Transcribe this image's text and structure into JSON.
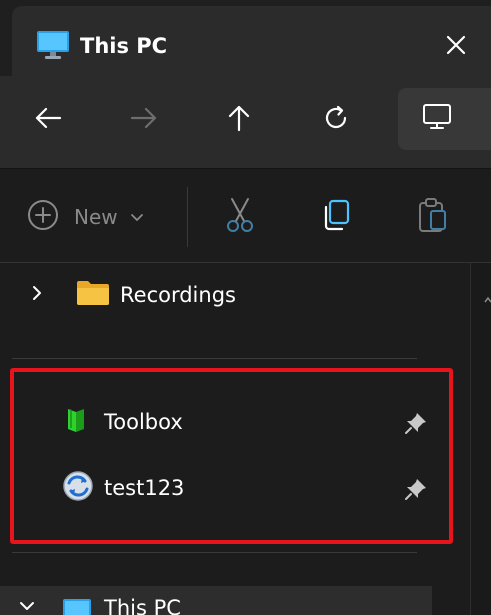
{
  "tab": {
    "title": "This PC",
    "icon": "monitor-icon",
    "close_icon": "close-icon"
  },
  "navigation": {
    "buttons": [
      {
        "name": "back",
        "icon": "arrow-left-icon",
        "enabled": true
      },
      {
        "name": "forward",
        "icon": "arrow-right-icon",
        "enabled": false
      },
      {
        "name": "up",
        "icon": "arrow-up-icon",
        "enabled": true
      },
      {
        "name": "refresh",
        "icon": "refresh-icon",
        "enabled": true
      },
      {
        "name": "view",
        "icon": "monitor-icon",
        "enabled": true
      }
    ]
  },
  "commandbar": {
    "new_label": "New",
    "new_icon": "plus-circle-icon",
    "actions": [
      {
        "name": "cut",
        "icon": "scissors-icon",
        "enabled": false
      },
      {
        "name": "copy",
        "icon": "copy-icon",
        "enabled": true
      },
      {
        "name": "paste",
        "icon": "clipboard-icon",
        "enabled": false
      }
    ]
  },
  "navpane": {
    "recordings_label": "Recordings",
    "pinned": [
      {
        "label": "Toolbox",
        "icon": "green-book-icon",
        "pinned": true
      },
      {
        "label": "test123",
        "icon": "sync-globe-icon",
        "pinned": true
      }
    ],
    "bottom_label": "This PC"
  },
  "colors": {
    "highlight": "#e8141c",
    "accent": "#4cc2ff",
    "folder": "#f6c342"
  }
}
